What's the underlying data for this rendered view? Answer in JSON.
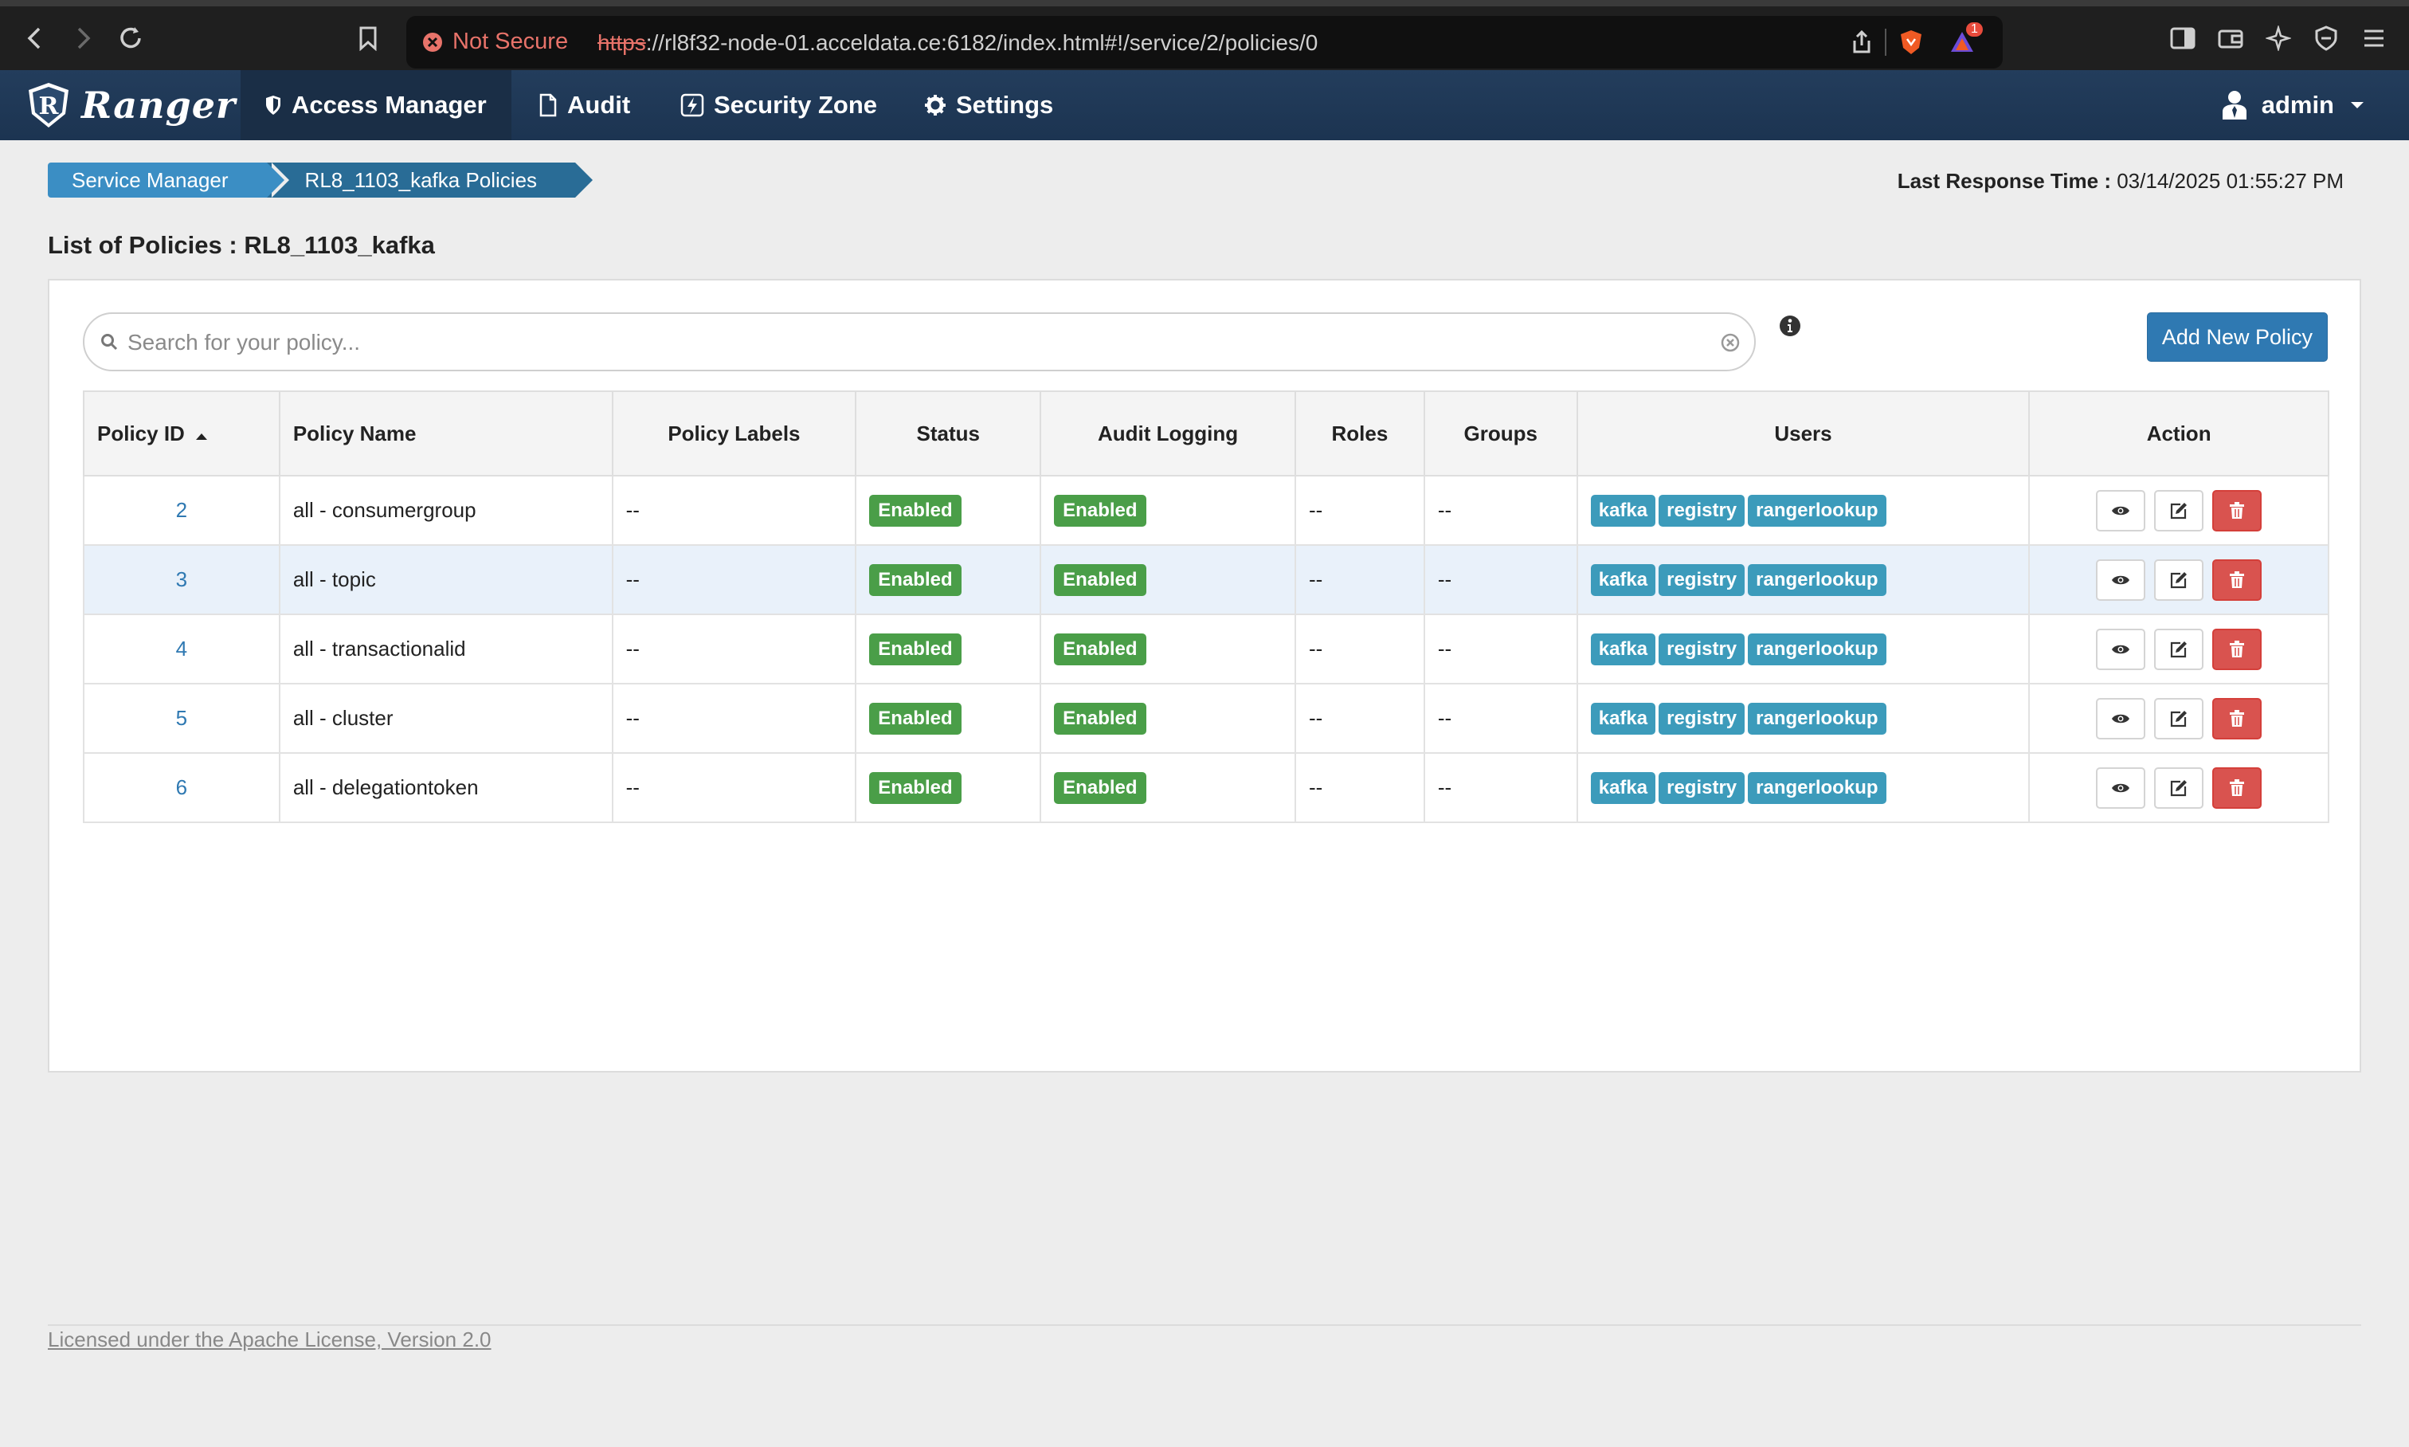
{
  "browser": {
    "security_label": "Not Secure",
    "url_scheme": "https",
    "url_rest": "://rl8f32-node-01.acceldata.ce:6182/index.html#!/service/2/policies/0",
    "notification_count": "1"
  },
  "navbar": {
    "brand": "Ranger",
    "items": [
      {
        "label": "Access Manager",
        "icon": "shield-icon"
      },
      {
        "label": "Audit",
        "icon": "file-icon"
      },
      {
        "label": "Security Zone",
        "icon": "zone-icon"
      },
      {
        "label": "Settings",
        "icon": "gear-icon"
      }
    ],
    "user": "admin"
  },
  "breadcrumb": [
    "Service Manager",
    "RL8_1103_kafka Policies"
  ],
  "last_response": {
    "label": "Last Response Time :",
    "value": "03/14/2025 01:55:27 PM"
  },
  "page_title": "List of Policies : RL8_1103_kafka",
  "search": {
    "placeholder": "Search for your policy..."
  },
  "add_button": "Add New Policy",
  "table": {
    "columns": [
      "Policy ID",
      "Policy Name",
      "Policy Labels",
      "Status",
      "Audit Logging",
      "Roles",
      "Groups",
      "Users",
      "Action"
    ],
    "rows": [
      {
        "id": "2",
        "name": "all - consumergroup",
        "labels": "--",
        "status": "Enabled",
        "audit": "Enabled",
        "roles": "--",
        "groups": "--",
        "users": [
          "kafka",
          "registry",
          "rangerlookup"
        ]
      },
      {
        "id": "3",
        "name": "all - topic",
        "labels": "--",
        "status": "Enabled",
        "audit": "Enabled",
        "roles": "--",
        "groups": "--",
        "users": [
          "kafka",
          "registry",
          "rangerlookup"
        ]
      },
      {
        "id": "4",
        "name": "all - transactionalid",
        "labels": "--",
        "status": "Enabled",
        "audit": "Enabled",
        "roles": "--",
        "groups": "--",
        "users": [
          "kafka",
          "registry",
          "rangerlookup"
        ]
      },
      {
        "id": "5",
        "name": "all - cluster",
        "labels": "--",
        "status": "Enabled",
        "audit": "Enabled",
        "roles": "--",
        "groups": "--",
        "users": [
          "kafka",
          "registry",
          "rangerlookup"
        ]
      },
      {
        "id": "6",
        "name": "all - delegationtoken",
        "labels": "--",
        "status": "Enabled",
        "audit": "Enabled",
        "roles": "--",
        "groups": "--",
        "users": [
          "kafka",
          "registry",
          "rangerlookup"
        ]
      }
    ]
  },
  "footer": {
    "license": "Licensed under the Apache License, Version 2.0"
  },
  "colors": {
    "navbar": "#1c3451",
    "enabled": "#4a9e48",
    "user_badge": "#3c9bbb",
    "primary": "#2f79b2",
    "danger": "#d9534f"
  }
}
